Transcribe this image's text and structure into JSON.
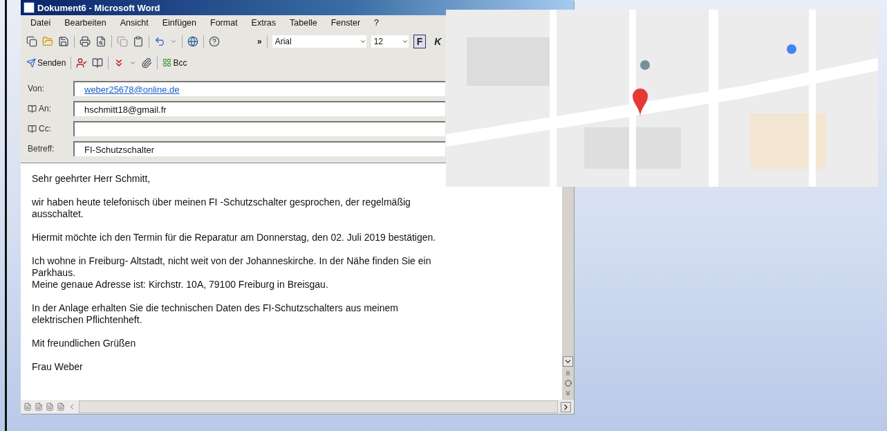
{
  "window": {
    "title": "Dokument6 - Microsoft Word"
  },
  "menu": [
    "Datei",
    "Bearbeiten",
    "Ansicht",
    "Einfügen",
    "Format",
    "Extras",
    "Tabelle",
    "Fenster",
    "?"
  ],
  "toolbar": {
    "more": "»",
    "font": "Arial",
    "size": "12",
    "bold": {
      "label": "F",
      "selected": true
    },
    "italic": {
      "label": "K",
      "selected": false
    }
  },
  "mail_toolbar": {
    "send": "Senden",
    "bcc": "Bcc"
  },
  "fields": [
    {
      "label": "Von:",
      "kind": "link",
      "value": "weber25678@online.de"
    },
    {
      "label": "An:",
      "kind": "book",
      "value": "hschmitt18@gmail.fr"
    },
    {
      "label": "Cc:",
      "kind": "book"
    },
    {
      "label": "Betreff:",
      "kind": "plain",
      "value": "FI-Schutzschalter"
    }
  ],
  "body": [
    [
      "Sehr geehrter Herr Schmitt,"
    ],
    [
      "wir haben heute telefonisch über meinen FI -Schutzschalter gesprochen, der regelmäßig",
      "ausschaltet."
    ],
    [
      "Hiermit möchte ich den Termin für die Reparatur am Donnerstag, den 02. Juli 2019 bestätigen."
    ],
    [
      "Ich wohne in Freiburg- Altstadt, nicht weit von der Johanneskirche. In der Nähe finden Sie ein",
      "Parkhaus.",
      "Meine genaue Adresse ist: Kirchstr. 10A, 79100 Freiburg in Breisgau."
    ],
    [
      "In der Anlage erhalten Sie die technischen Daten des FI-Schutzschalters aus meinem",
      "elektrischen Pflichtenheft."
    ],
    [
      "Mit freundlichen Grüßen"
    ],
    [
      "Frau Weber"
    ]
  ],
  "map": {
    "kind": "picture"
  }
}
